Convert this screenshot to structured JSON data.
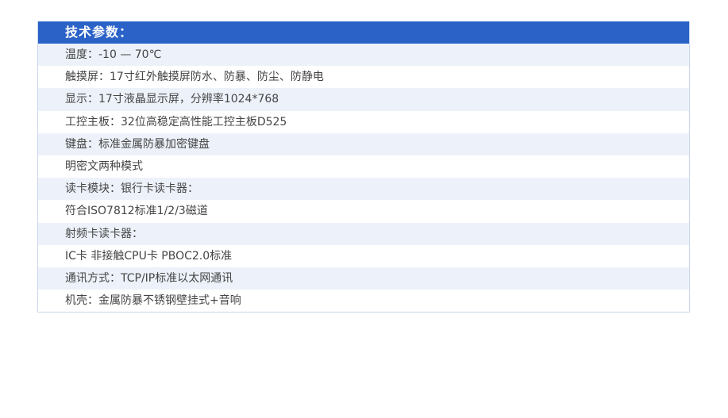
{
  "spec": {
    "title": "技术参数：",
    "rows": [
      "温度：-10 — 70℃",
      "触摸屏：17寸红外触摸屏防水、防暴、防尘、防静电",
      "显示：17寸液晶显示屏，分辨率1024*768",
      "工控主板：32位高稳定高性能工控主板D525",
      "键盘：标准金属防暴加密键盘",
      "明密文两种模式",
      "读卡模块：银行卡读卡器：",
      "符合ISO7812标准1/2/3磁道",
      "射频卡读卡器：",
      "IC卡 非接触CPU卡 PBOC2.0标准",
      "通讯方式：TCP/IP标准以太网通讯",
      "机壳：金属防暴不锈钢壁挂式+音响"
    ]
  },
  "colors": {
    "header_bg": "#2b62c7",
    "alt_row_bg": "#edf2fa",
    "border": "#c9d6ee"
  }
}
